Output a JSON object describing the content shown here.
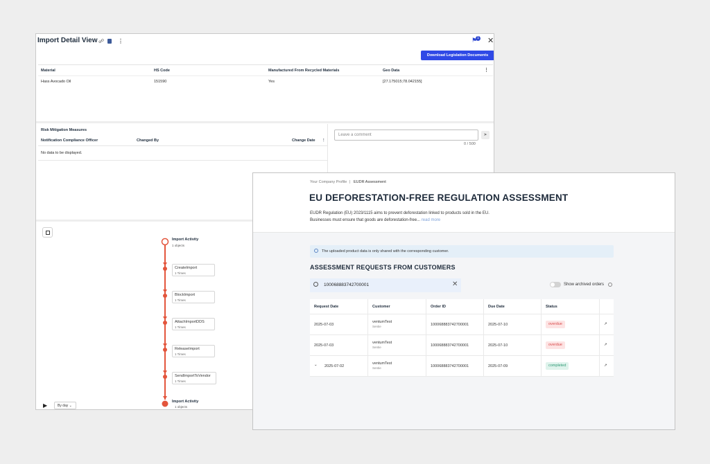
{
  "import_view": {
    "title": "Import Detail View",
    "download_button": "Download Legislation Documents",
    "notification_count": "1",
    "materials": {
      "headers": [
        "Material",
        "HS Code",
        "Manufactured From Recycled Materials",
        "Geo Data"
      ],
      "row": [
        "Hass Avocado Oil",
        "151590",
        "Yes",
        "[27.175015;78.042155]"
      ]
    },
    "risk": {
      "title": "Risk Mitigation Measures",
      "headers": [
        "Notification Compliance Officer",
        "Changed By",
        "Change Date"
      ],
      "empty_text": "No data to be displayed."
    },
    "comment": {
      "placeholder": "Leave a comment",
      "counter": "0 / 500"
    },
    "flow": {
      "start": {
        "title": "Import Activity",
        "sub": "1 objects"
      },
      "end": {
        "title": "Import Activity",
        "sub": "1 objects"
      },
      "steps": [
        {
          "label": "CreateImport",
          "count": "1 Times"
        },
        {
          "label": "BlockImport",
          "count": "1 Times"
        },
        {
          "label": "AttachImportDDS",
          "count": "1 Times"
        },
        {
          "label": "ReleaseImport",
          "count": "1 Times"
        },
        {
          "label": "SendImportToVendor",
          "count": "1 Times"
        }
      ],
      "granularity": "By day"
    }
  },
  "eudr": {
    "breadcrumb": [
      "Your Company Profile",
      "EUDR Assessment"
    ],
    "title": "EU DEFORESTATION-FREE REGULATION ASSESSMENT",
    "description_line1": "EUDR Regulation (EU) 2023/1115 aims to prevent deforestation linked to products sold in the EU.",
    "description_line2": "Businesses must ensure that goods are deforestation-free...",
    "read_more": "read more",
    "info_text": "The uploaded product data is only shared with the corresponding customer.",
    "section_title": "ASSESSMENT REQUESTS FROM CUSTOMERS",
    "search_value": "100068883742700001",
    "show_archived_label": "Show archived orders",
    "show_archived": false,
    "table": {
      "headers": [
        "Request Date",
        "Customer",
        "Order ID",
        "Due Date",
        "Status"
      ],
      "rows": [
        {
          "request_date": "2025-07-03",
          "customer": "ventumTest",
          "customer_role": "Sentie",
          "order_id": "100068883742700001",
          "due_date": "2025-07-10",
          "status": "overdue"
        },
        {
          "request_date": "2025-07-03",
          "customer": "ventumTest",
          "customer_role": "Sentie",
          "order_id": "100068883742700001",
          "due_date": "2025-07-10",
          "status": "overdue"
        },
        {
          "request_date": "2025-07-02",
          "customer": "ventumTest",
          "customer_role": "Sentie",
          "order_id": "100068883742700001",
          "due_date": "2025-07-09",
          "status": "completed"
        }
      ]
    },
    "colors": {
      "primary": "#2f49e6",
      "overdue": "#d84a4a",
      "completed": "#2f9a75",
      "flow": "#e3553c"
    }
  }
}
